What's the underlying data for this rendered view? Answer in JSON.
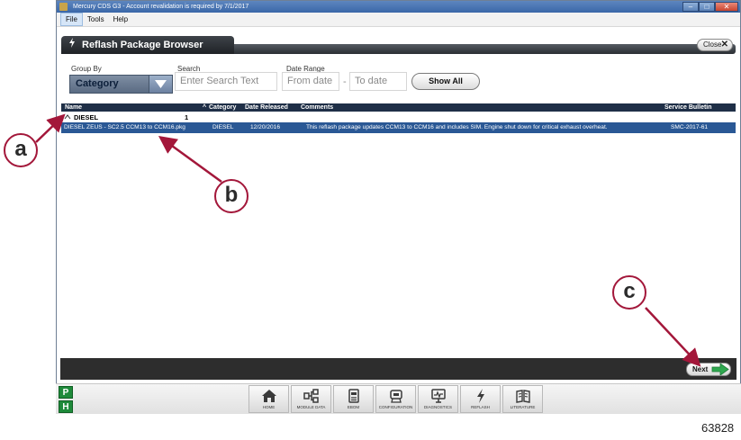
{
  "window": {
    "title": "Mercury CDS G3 - Account revalidation is required by 7/1/2017",
    "controls": {
      "minimize": "–",
      "maximize": "□",
      "close": "✕"
    }
  },
  "menu": {
    "items": [
      "File",
      "Tools",
      "Help"
    ]
  },
  "page": {
    "tab_title": "Reflash Package Browser",
    "close_label": "Close"
  },
  "filters": {
    "group_by_label": "Group By",
    "group_by_value": "Category",
    "search_label": "Search",
    "search_placeholder": "Enter Search Text",
    "date_range_label": "Date Range",
    "from_placeholder": "From date",
    "to_placeholder": "To date",
    "date_separator": "-",
    "show_all": "Show All"
  },
  "table": {
    "headers": {
      "name": "Name",
      "category": "Category",
      "date_released": "Date Released",
      "comments": "Comments",
      "service_bulletin": "Service Bulletin"
    },
    "group": {
      "name": "DIESEL",
      "count": "1"
    },
    "rows": [
      {
        "name": "DIESEL ZEUS - SC2.5 CCM13 to CCM16.pkg",
        "category": "DIESEL",
        "date_released": "12/20/2016",
        "comments": "This reflash package updates CCM13 to CCM16 and includes SIM. Engine shut down for critical exhaust overheat.",
        "service_bulletin": "SMC-2017-61"
      }
    ]
  },
  "footer": {
    "next_label": "Next"
  },
  "side_badges": [
    "P",
    "H"
  ],
  "nav": {
    "items": [
      "HOME",
      "MODULE DATA",
      "EBOM",
      "CONFIGURATION",
      "DIAGNOSTICS",
      "REFLASH",
      "LITERATURE"
    ]
  },
  "annotations": {
    "a": "a",
    "b": "b",
    "c": "c"
  },
  "figure_number": "63828",
  "colors": {
    "header_dark": "#1f2f47",
    "selection": "#2a5895",
    "callout_border": "#a3173a",
    "arrow": "#a3173a",
    "next_arrow": "#2fa84f",
    "badge_green": "#1e8a3a"
  }
}
